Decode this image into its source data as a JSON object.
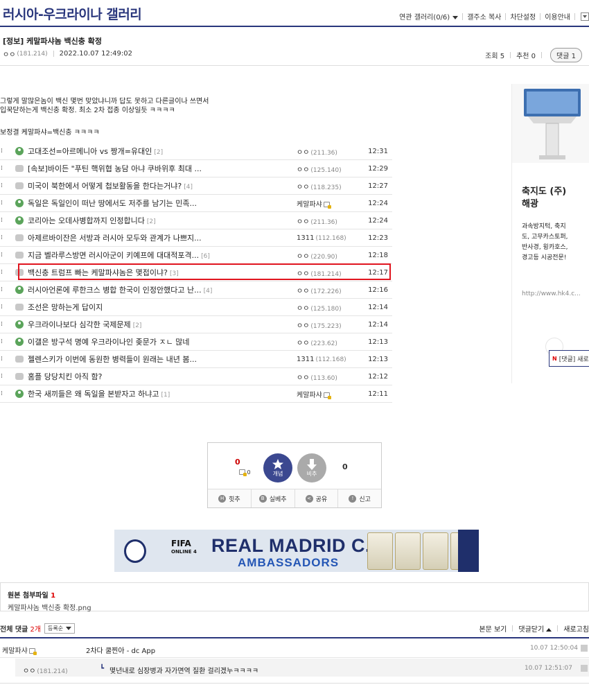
{
  "gallery": {
    "title": "러시아-우크라이나 갤러리"
  },
  "top_links": {
    "related": "연관 갤러리(0/6)",
    "copy_url": "갤주소 복사",
    "block": "차단설정",
    "guide": "이용안내"
  },
  "post": {
    "title": "[정보] 케말파샤놈 백신충 확정",
    "writer": "ㅇㅇ",
    "ip": "(181.214)",
    "date": "2022.10.07 12:49:02",
    "views_label": "조회 5",
    "recommend_label": "추천 0",
    "comment_label": "댓글 1",
    "body_line1": "그렇게 말많은놈이 백신 몇번 맞았냐니까 답도 못하고 다른글이나 쓰면서",
    "body_line2": "입꾹닫하는게 백신충 확정. 최소 2차 접종 이상일듯 ㅋㅋㅋㅋ",
    "body_line3": "보정결 케말파샤=백신충 ㅋㅋㅋㅋ"
  },
  "posts": [
    {
      "icon": "green",
      "title": "고대조선=아르메니아 vs 짱개=유대인",
      "count": "[2]",
      "writer": "ㅇㅇ",
      "ip": "(211.36)",
      "time": "12:31"
    },
    {
      "icon": "gray",
      "title": "[속보]바이든 \"푸틴 핵위협 농담 아냐 쿠바위후 최대 ...",
      "count": "",
      "writer": "ㅇㅇ",
      "ip": "(125.140)",
      "time": "12:29"
    },
    {
      "icon": "gray",
      "title": "미국이 북한에서 어떻게 첩보활동을 한다는거냐?",
      "count": "[4]",
      "writer": "ㅇㅇ",
      "ip": "(118.235)",
      "time": "12:27"
    },
    {
      "icon": "green",
      "title": "독일은 독일인이 떠난 땅에서도 저주를 남기는 민족...",
      "count": "",
      "writer": "케말파샤",
      "ip": "",
      "fixed": true,
      "time": "12:24"
    },
    {
      "icon": "green",
      "title": "코리아는 오데사병합까지 인정합니다",
      "count": "[2]",
      "writer": "ㅇㅇ",
      "ip": "(211.36)",
      "time": "12:24"
    },
    {
      "icon": "gray",
      "title": "아제르바이잔은 서방과 러시아 모두와 관계가 나쁘지...",
      "count": "",
      "writer": "1311",
      "ip": "(112.168)",
      "time": "12:23"
    },
    {
      "icon": "gray",
      "title": "지금 벨라루스방면 러시아군이 키예프에 대대적포격...",
      "count": "[6]",
      "writer": "ㅇㅇ",
      "ip": "(220.90)",
      "time": "12:18"
    },
    {
      "icon": "gray",
      "title": "백신충 트럼프 빠는 케말파샤놈은 몇접이냐?",
      "count": "[3]",
      "writer": "ㅇㅇ",
      "ip": "(181.214)",
      "time": "12:17"
    },
    {
      "icon": "green",
      "title": "러시아언론에 루한크스 병합 한국이 인정안했다고 난...",
      "count": "[4]",
      "writer": "ㅇㅇ",
      "ip": "(172.226)",
      "time": "12:16"
    },
    {
      "icon": "gray",
      "title": "조선은 망하는게 답이지",
      "count": "",
      "writer": "ㅇㅇ",
      "ip": "(125.180)",
      "time": "12:14"
    },
    {
      "icon": "green",
      "title": "우크라이나보다 심각한 국제문제",
      "count": "[2]",
      "writer": "ㅇㅇ",
      "ip": "(175.223)",
      "time": "12:14"
    },
    {
      "icon": "green",
      "title": "이갤은 방구석 명예 우크라이나인 좆문가 ㅈㄴ 많네",
      "count": "",
      "writer": "ㅇㅇ",
      "ip": "(223.62)",
      "time": "12:13"
    },
    {
      "icon": "gray",
      "title": "젤렌스키가 이번에 동원한 병력들이 원래는 내년 봄...",
      "count": "",
      "writer": "1311",
      "ip": "(112.168)",
      "time": "12:13"
    },
    {
      "icon": "gray",
      "title": "홈플 당당치킨 아직 함?",
      "count": "",
      "writer": "ㅇㅇ",
      "ip": "(113.60)",
      "time": "12:12"
    },
    {
      "icon": "green",
      "title": "한국 새끼들은 왜 독일을 본받자고 하냐고",
      "count": "[1]",
      "writer": "케말파샤",
      "ip": "",
      "fixed": true,
      "time": "12:11"
    }
  ],
  "ad": {
    "heading1": "축지도 (주)",
    "heading2": "해광",
    "desc1": "과속방지턱, 축지",
    "desc2": "도, 고무카스토퍼,",
    "desc3": "반사경, 윙카호스,",
    "desc4": "경고등 시공전문!",
    "url": "http://www.hk4.c...",
    "reply_tip_n": "N",
    "reply_tip": "[댓글] 새로"
  },
  "vote": {
    "up_count": "0",
    "fixed_up": "0",
    "up_label": "개념",
    "down_label": "비추",
    "down_count": "0",
    "bar": [
      "힛추",
      "실베추",
      "공유",
      "신고"
    ]
  },
  "banner": {
    "fifa": "FIFA",
    "fifa_sub": "ONLINE 4",
    "line1": "REAL MADRID C.F.",
    "line2": "AMBASSADORS"
  },
  "attachment": {
    "label": "원본 첨부파일",
    "count": "1",
    "file": "케말파샤놈 백신충 확정.png"
  },
  "comments_header": {
    "label": "전체 댓글",
    "count": "2개",
    "sort": "등록순",
    "view_body": "본문 보기",
    "close": "댓글닫기",
    "refresh": "새로고침"
  },
  "comments": [
    {
      "writer": "케말파샤",
      "text": "2차다 쿨찐아 - dc App",
      "date": "10.07 12:50:04"
    },
    {
      "writer": "ㅇㅇ",
      "ip": "(181.214)",
      "text": "몇년내로 심장병과 자가면역 질환 걸리겠누ㅋㅋㅋㅋ",
      "date": "10.07 12:51:07"
    }
  ]
}
